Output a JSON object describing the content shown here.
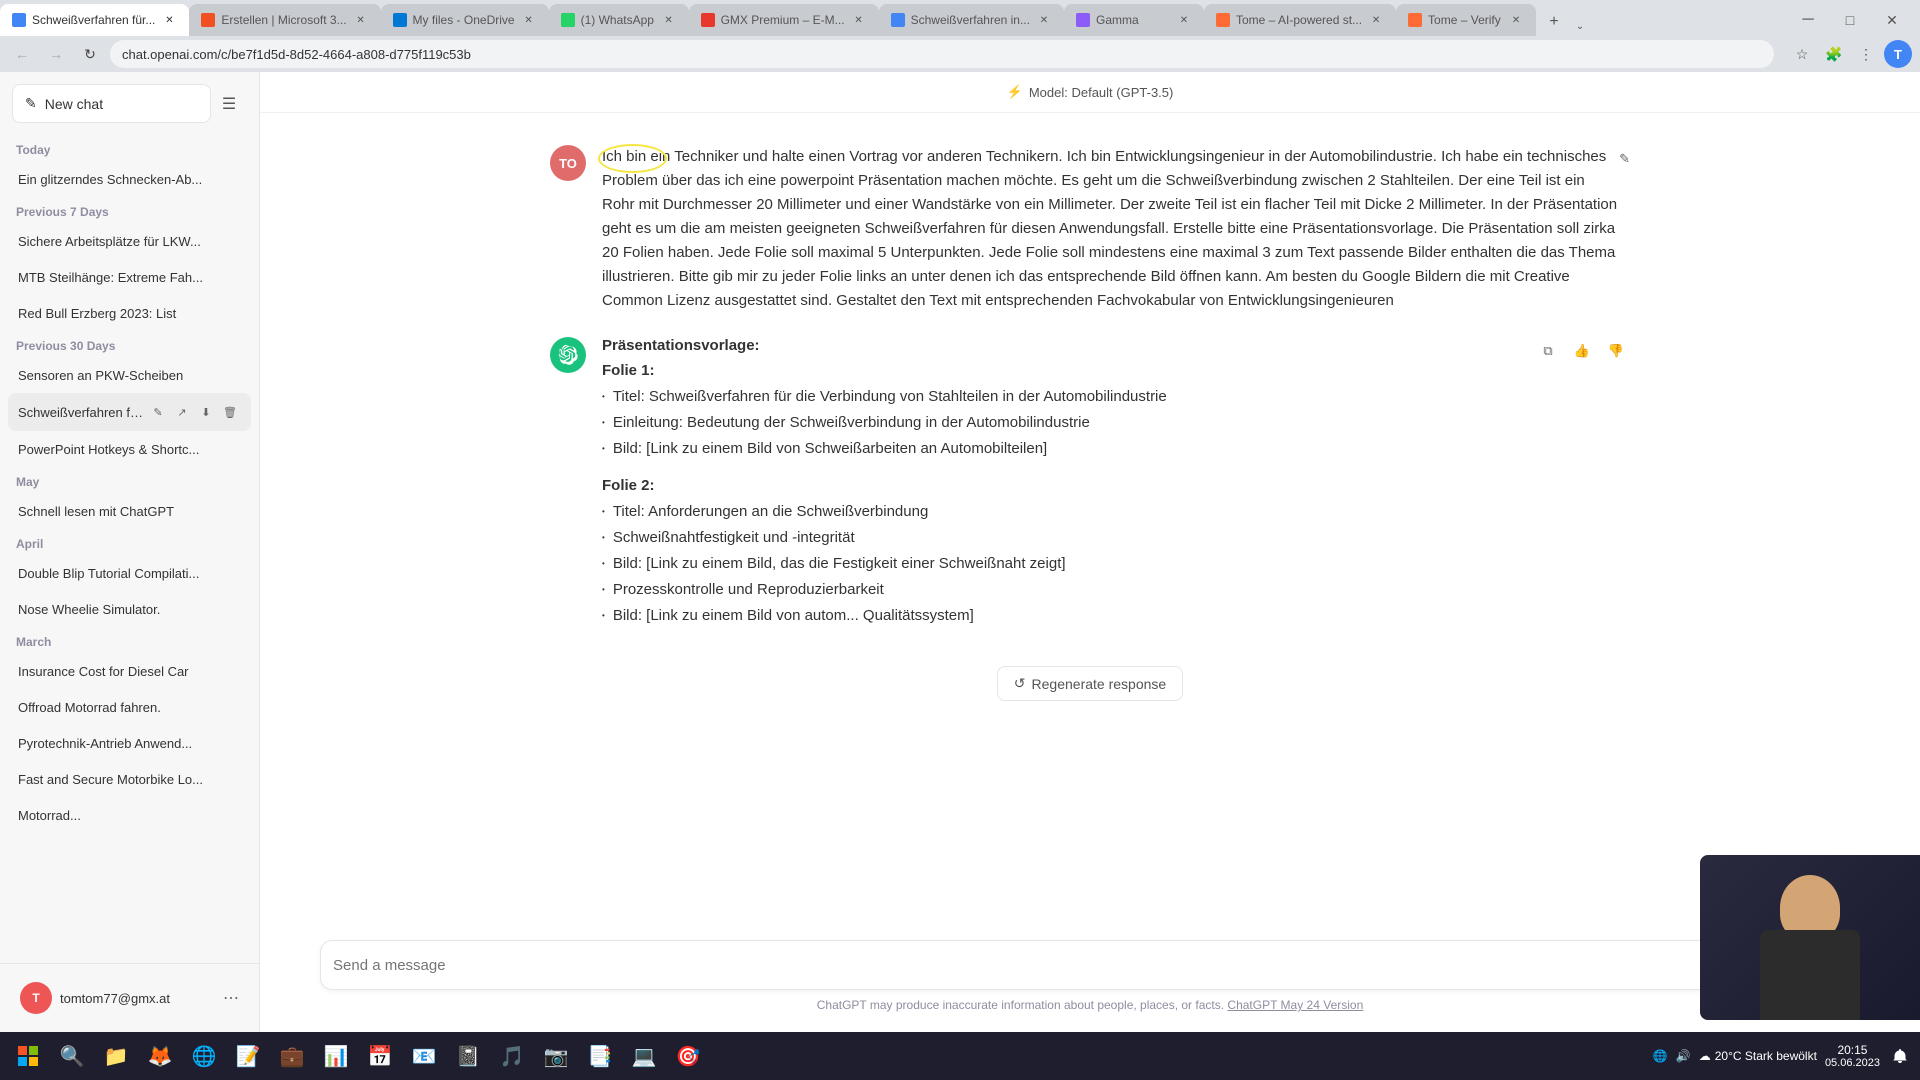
{
  "browser": {
    "tabs": [
      {
        "id": "tab1",
        "title": "Schweißverfahren für...",
        "favicon_color": "#4285f4",
        "active": true
      },
      {
        "id": "tab2",
        "title": "Erstellen | Microsoft 3...",
        "favicon_color": "#f25022",
        "active": false
      },
      {
        "id": "tab3",
        "title": "My files - OneDrive",
        "favicon_color": "#0078d4",
        "active": false
      },
      {
        "id": "tab4",
        "title": "(1) WhatsApp",
        "favicon_color": "#25d366",
        "active": false
      },
      {
        "id": "tab5",
        "title": "GMX Premium – E-M...",
        "favicon_color": "#e8372c",
        "active": false
      },
      {
        "id": "tab6",
        "title": "Schweißverfahren in...",
        "favicon_color": "#4285f4",
        "active": false
      },
      {
        "id": "tab7",
        "title": "Gamma",
        "favicon_color": "#8b5cf6",
        "active": false
      },
      {
        "id": "tab8",
        "title": "Tome – AI-powered st...",
        "favicon_color": "#ff6b35",
        "active": false
      },
      {
        "id": "tab9",
        "title": "Tome – Verify",
        "favicon_color": "#ff6b35",
        "active": false
      }
    ],
    "address": "chat.openai.com/c/be7f1d5d-8d52-4664-a808-d775f119c53b",
    "nav": {
      "back_disabled": false,
      "forward_disabled": true
    }
  },
  "header": {
    "model_label": "Model: Default (GPT-3.5)",
    "lightning_icon": "⚡"
  },
  "sidebar": {
    "new_chat_label": "New chat",
    "sections": [
      {
        "label": "Today",
        "items": [
          {
            "id": "item1",
            "text": "Ein glitzerndes Schnecken-Ab...",
            "active": false
          }
        ]
      },
      {
        "label": "Previous 7 Days",
        "items": [
          {
            "id": "item2",
            "text": "Sichere Arbeitsplätze für LKW...",
            "active": false
          },
          {
            "id": "item3",
            "text": "MTB Steilhänge: Extreme Fah...",
            "active": false
          },
          {
            "id": "item4",
            "text": "Red Bull Erzberg 2023: List",
            "active": false
          }
        ]
      },
      {
        "label": "Previous 30 Days",
        "items": [
          {
            "id": "item5",
            "text": "Sensoren an PKW-Scheiben",
            "active": false
          },
          {
            "id": "item6",
            "text": "Schweißverfahren fü...",
            "active": true
          },
          {
            "id": "item7",
            "text": "PowerPoint Hotkeys & Shortc...",
            "active": false
          }
        ]
      },
      {
        "label": "May",
        "items": [
          {
            "id": "item8",
            "text": "Schnell lesen mit ChatGPT",
            "active": false
          }
        ]
      },
      {
        "label": "April",
        "items": [
          {
            "id": "item9",
            "text": "Double Blip Tutorial Compilati...",
            "active": false
          },
          {
            "id": "item10",
            "text": "Nose Wheelie Simulator.",
            "active": false
          }
        ]
      },
      {
        "label": "March",
        "items": [
          {
            "id": "item11",
            "text": "Insurance Cost for Diesel Car",
            "active": false
          },
          {
            "id": "item12",
            "text": "Offroad Motorrad fahren.",
            "active": false
          },
          {
            "id": "item13",
            "text": "Pyrotechnik-Antrieb Anwend...",
            "active": false
          },
          {
            "id": "item14",
            "text": "Fast and Secure Motorbike Lo...",
            "active": false
          },
          {
            "id": "item15",
            "text": "Motorrad...",
            "active": false
          }
        ]
      }
    ],
    "user": {
      "email": "tomtom77@gmx.at",
      "avatar_initials": "T"
    }
  },
  "chat": {
    "user_message": "Ich bin ein Techniker und halte einen Vortrag vor anderen Technikern. Ich bin Entwicklungsingenieur in der Automobilindustrie. Ich habe ein technisches Problem über das ich eine powerpoint Präsentation machen möchte. Es geht um die Schweißverbindung zwischen 2 Stahlteilen. Der eine Teil ist ein Rohr mit Durchmesser 20 Millimeter und einer Wandstärke von ein Millimeter. Der zweite Teil ist ein flacher Teil mit Dicke 2 Millimeter. In der Präsentation geht es um die am meisten geeigneten Schweißverfahren für diesen Anwendungsfall. Erstelle bitte eine Präsentationsvorlage. Die Präsentation soll zirka 20 Folien haben. Jede Folie soll maximal 5 Unterpunkten. Jede Folie soll mindestens eine maximal 3 zum Text passende Bilder enthalten die das Thema illustrieren. Bitte gib mir zu jeder Folie links an unter denen ich das entsprechende Bild öffnen kann. Am besten du Google Bildern die mit Creative Common Lizenz ausgestattet sind. Gestaltet den Text mit entsprechenden Fachvokabular von Entwicklungsingenieuren",
    "ai_response_title": "Präsentationsvorlage:",
    "slides": [
      {
        "title": "Folie 1:",
        "bullets": [
          "Titel: Schweißverfahren für die Verbindung von Stahlteilen in der Automobilindustrie",
          "Einleitung: Bedeutung der Schweißverbindung in der Automobilindustrie",
          "Bild: [Link zu einem Bild von Schweißarbeiten an Automobilteilen]"
        ]
      },
      {
        "title": "Folie 2:",
        "bullets": [
          "Titel: Anforderungen an die Schweißverbindung",
          "Schweißnahtfestigkeit und -integrität",
          "Bild: [Link zu einem Bild, das die Festigkeit einer Schweißnaht zeigt]",
          "Prozesskontrolle und Reproduzierbarkeit",
          "Bild: [Link zu einem Bild von autom... Qualitätssystem]"
        ]
      }
    ],
    "regenerate_label": "Regenerate response",
    "input_placeholder": "Send a message",
    "send_icon": "▶",
    "disclaimer": "ChatGPT may produce inaccurate information about people, places, or facts.",
    "disclaimer_link": "ChatGPT May 24 Version"
  },
  "taskbar": {
    "time": "20°C  Stark bewölkt",
    "clock": "20:15",
    "apps": [
      "🪟",
      "📁",
      "🦊",
      "🌐",
      "📝",
      "💼",
      "📊",
      "📅",
      "📧",
      "📋",
      "🎵",
      "🎮",
      "📷",
      "📑",
      "💻",
      "🎯"
    ]
  }
}
